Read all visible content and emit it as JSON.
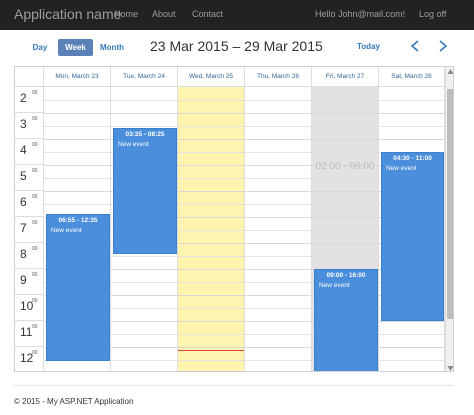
{
  "navbar": {
    "brand": "Application name",
    "links": [
      "Home",
      "About",
      "Contact"
    ],
    "user": "Hello John@mail.com!",
    "logoff": "Log off"
  },
  "toolbar": {
    "views": [
      "Day",
      "Week",
      "Month"
    ],
    "active_view": "Week",
    "range_title": "23 Mar 2015 – 29 Mar 2015",
    "today_label": "Today",
    "prev_icon": "chevron-left-icon",
    "next_icon": "chevron-right-icon"
  },
  "calendar": {
    "days": [
      "Mon, March 23",
      "Tue, March 24",
      "Wed, March 25",
      "Thu, March 26",
      "Fri, March 27",
      "Sat, March 28"
    ],
    "hours": [
      {
        "h": "2",
        "m": "00"
      },
      {
        "h": "3",
        "m": "00"
      },
      {
        "h": "4",
        "m": "00"
      },
      {
        "h": "5",
        "m": "00"
      },
      {
        "h": "6",
        "m": "00"
      },
      {
        "h": "7",
        "m": "00"
      },
      {
        "h": "8",
        "m": "00"
      },
      {
        "h": "9",
        "m": "00"
      },
      {
        "h": "10",
        "m": "00"
      },
      {
        "h": "11",
        "m": "00"
      },
      {
        "h": "12",
        "m": "00"
      }
    ],
    "disabled_text": "02:00 - 06:00",
    "events": [
      {
        "time": "06:55 - 12:35",
        "title": "New event"
      },
      {
        "time": "03:35 - 08:25",
        "title": "New event"
      },
      {
        "time": "09:00 - 16:00",
        "title": "New event"
      },
      {
        "time": "04:30 - 11:00",
        "title": "New event"
      }
    ],
    "colors": {
      "event": "#4a8edc",
      "today": "#fff3b0",
      "disabled": "#e2e2e2",
      "now_line": "#e0453a",
      "navbar": "#222222",
      "active_view": "#5b82b8"
    }
  },
  "footer": "© 2015 - My ASP.NET Application"
}
